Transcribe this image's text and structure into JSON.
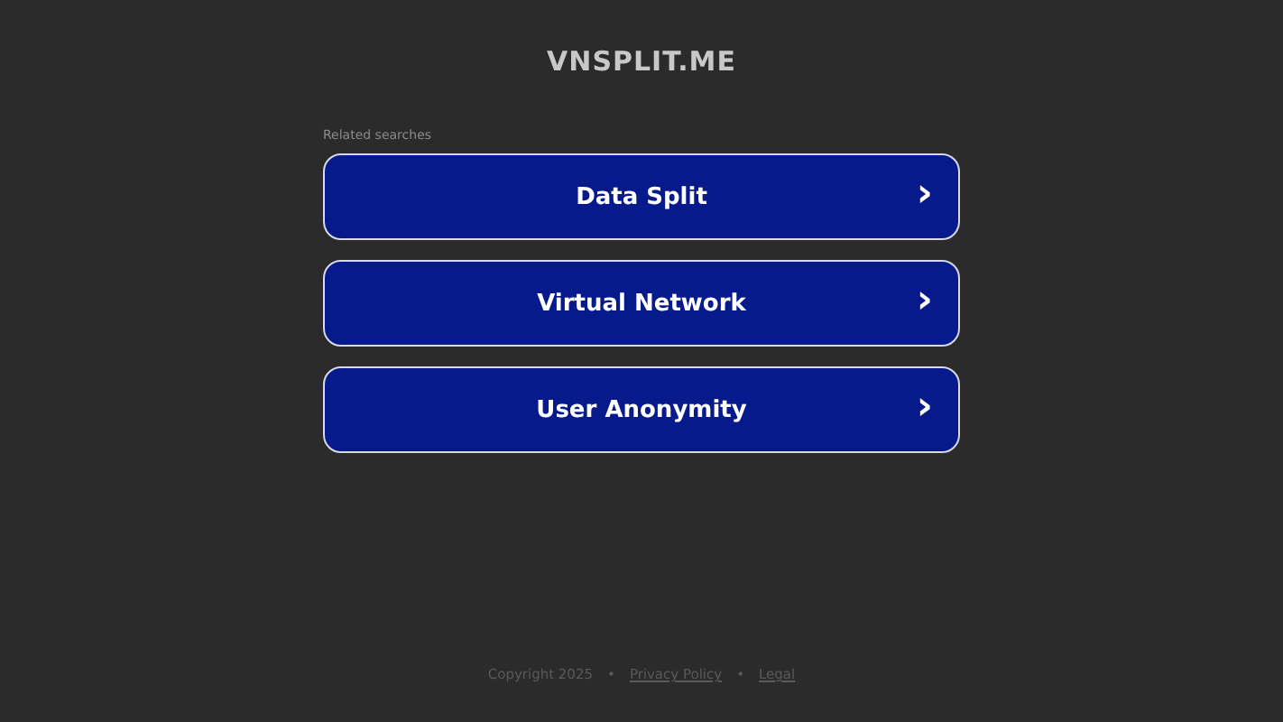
{
  "site_title": "VNSPLIT.ME",
  "related_label": "Related searches",
  "links": [
    {
      "label": "Data Split",
      "arrow": "›"
    },
    {
      "label": "Virtual Network",
      "arrow": "›"
    },
    {
      "label": "User Anonymity",
      "arrow": "›"
    }
  ],
  "footer": {
    "copyright": "Copyright 2025",
    "separators": [
      "•",
      "•"
    ],
    "links": [
      "Privacy Policy",
      "Legal"
    ]
  }
}
